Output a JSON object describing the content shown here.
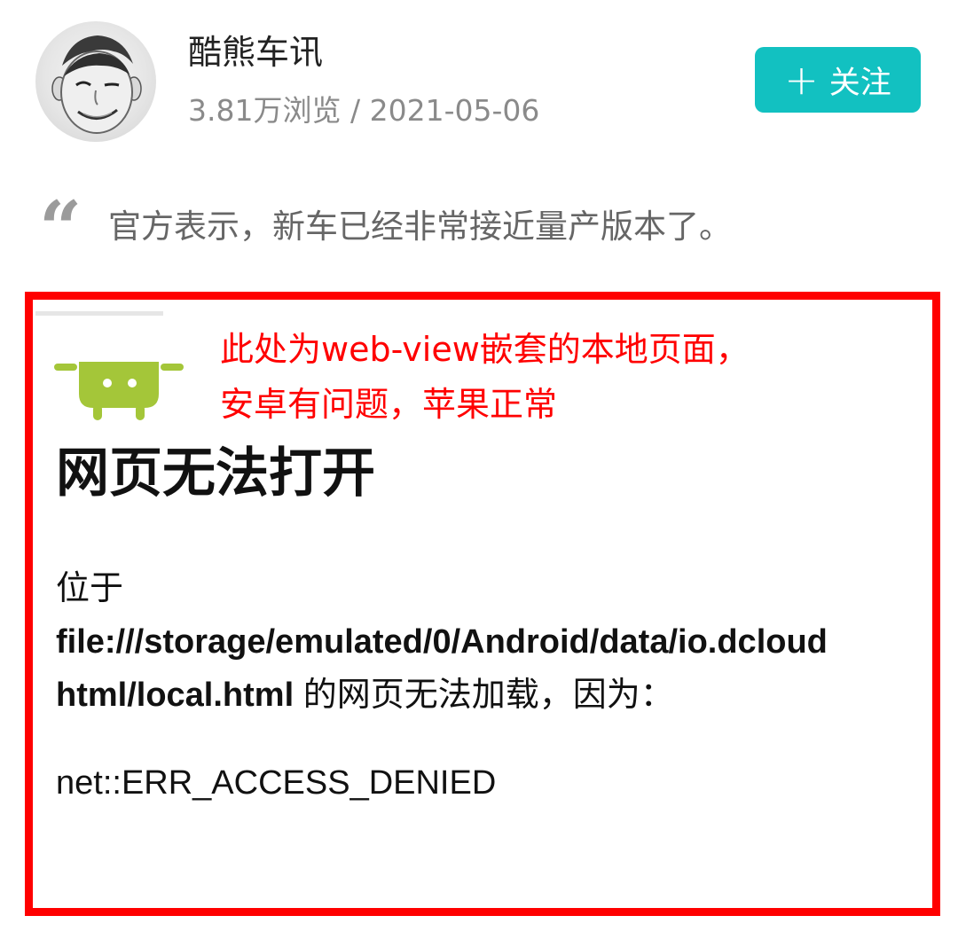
{
  "header": {
    "author_name": "酷熊车讯",
    "views": "3.81万浏览",
    "separator": "/",
    "date": "2021-05-06",
    "follow_button": {
      "plus": "+",
      "label": "关注",
      "color": "#12c1c1"
    }
  },
  "quote": {
    "mark": "“",
    "text": "官方表示，新车已经非常接近量产版本了。"
  },
  "webview": {
    "frame_color": "#ff0000",
    "annotation_line1": "此处为web-view嵌套的本地页面，",
    "annotation_line2": "安卓有问题，苹果正常",
    "error_title": "网页无法打开",
    "error_prefix": "位于",
    "error_url_line1": "file:///storage/emulated/0/Android/data/io.dcloud",
    "error_url_line2": "html/local.html",
    "error_suffix": " 的网页无法加载，因为：",
    "error_code": "net::ERR_ACCESS_DENIED",
    "icon": "android-robot-icon"
  }
}
